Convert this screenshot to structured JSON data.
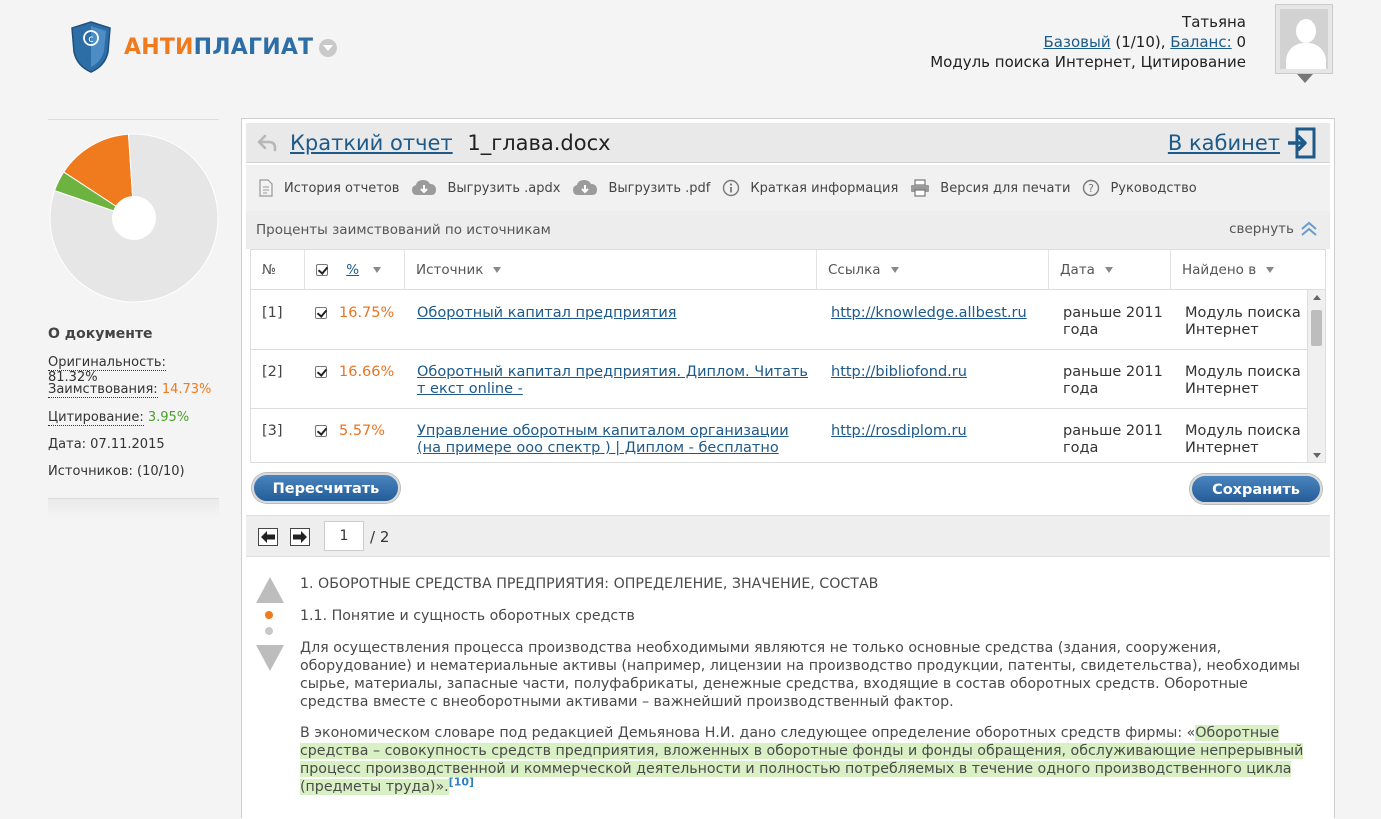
{
  "brand": {
    "part1": "АНТИ",
    "part2": "ПЛАГИАТ"
  },
  "user": {
    "name": "Татьяна",
    "plan_link": "Базовый",
    "plan_count": "(1/10),",
    "balance_link": "Баланс:",
    "balance_value": "0",
    "modules": "Модуль поиска Интернет, Цитирование"
  },
  "sidebar": {
    "pie": {
      "originality": 81.32,
      "borrowing": 14.73,
      "citation": 3.95
    },
    "about_title": "О документе",
    "originality_label": "Оригинальность:",
    "originality_value": "81.32%",
    "borrowing_label": "Заимствования:",
    "borrowing_value": "14.73%",
    "citation_label": "Цитирование:",
    "citation_value": "3.95%",
    "date_text": "Дата: 07.11.2015",
    "sources_text": "Источников: (10/10)"
  },
  "report": {
    "title_link": "Краткий отчет",
    "file_name": "1_глава.docx",
    "cabinet_link": "В кабинет"
  },
  "toolbar": {
    "history": "История отчетов",
    "export_apdx": "Выгрузить .apdx",
    "export_pdf": "Выгрузить .pdf",
    "brief_info": "Краткая информация",
    "print_version": "Версия для печати",
    "guide": "Руководство"
  },
  "sources": {
    "heading": "Проценты заимствований по источникам",
    "collapse": "свернуть",
    "columns": {
      "num": "№",
      "pct": "%",
      "source": "Источник",
      "link": "Ссылка",
      "date": "Дата",
      "found": "Найдено в"
    },
    "rows": [
      {
        "num": "[1]",
        "pct": "16.75%",
        "source": "Оборотный капитал предприятия",
        "url": "http://knowledge.allbest.ru",
        "date": "раньше 2011 года",
        "found": "Модуль поиска Интернет"
      },
      {
        "num": "[2]",
        "pct": "16.66%",
        "source": "Оборотный капитал предприятия. Диплом. Читать т екст online -",
        "url": "http://bibliofond.ru",
        "date": "раньше 2011 года",
        "found": "Модуль поиска Интернет"
      },
      {
        "num": "[3]",
        "pct": "5.57%",
        "source": "Управление оборотным капиталом организации (на примере ооо спектр ) | Диплом - бесплатно",
        "url": "http://rosdiplom.ru",
        "date": "раньше 2011 года",
        "found": "Модуль поиска Интернет"
      }
    ]
  },
  "buttons": {
    "recalc": "Пересчитать",
    "save": "Сохранить"
  },
  "pager": {
    "current": "1",
    "total": "/ 2"
  },
  "document": {
    "heading1": "1. ОБОРОТНЫЕ СРЕДСТВА ПРЕДПРИЯТИЯ: ОПРЕДЕЛЕНИЕ, ЗНАЧЕНИЕ, СОСТАВ",
    "heading2": "1.1. Понятие и сущность оборотных средств",
    "para1": "Для осуществления процесса производства необходимыми являются не только основные средства (здания, сооружения, оборудование) и нематериальные активы (например, лицензии на производство продукции, патенты, свидетельства), необходимы сырье, материалы, запасные части, полуфабрикаты, денежные средства, входящие в состав оборотных средств. Оборотные средства вместе с внеоборотными активами – важнейший производственный фактор.",
    "para2_plain": "В экономическом словаре под редакцией Демьянова Н.И. дано следующее определение оборотных средств фирмы: «",
    "para2_highlight": "Оборотные средства – совокупность средств предприятия, вложенных в оборотные фонды и фонды обращения, обслуживающие непрерывный процесс производственной и коммерческой деятельности и полностью потребляемых в течение одного производственного цикла (предметы труда)».",
    "para2_ref": "[10]"
  },
  "colors": {
    "borrowing": "#f07a1e",
    "citation": "#6cb33f",
    "originality": "#e6e6e6",
    "link": "#1d5a8a"
  }
}
